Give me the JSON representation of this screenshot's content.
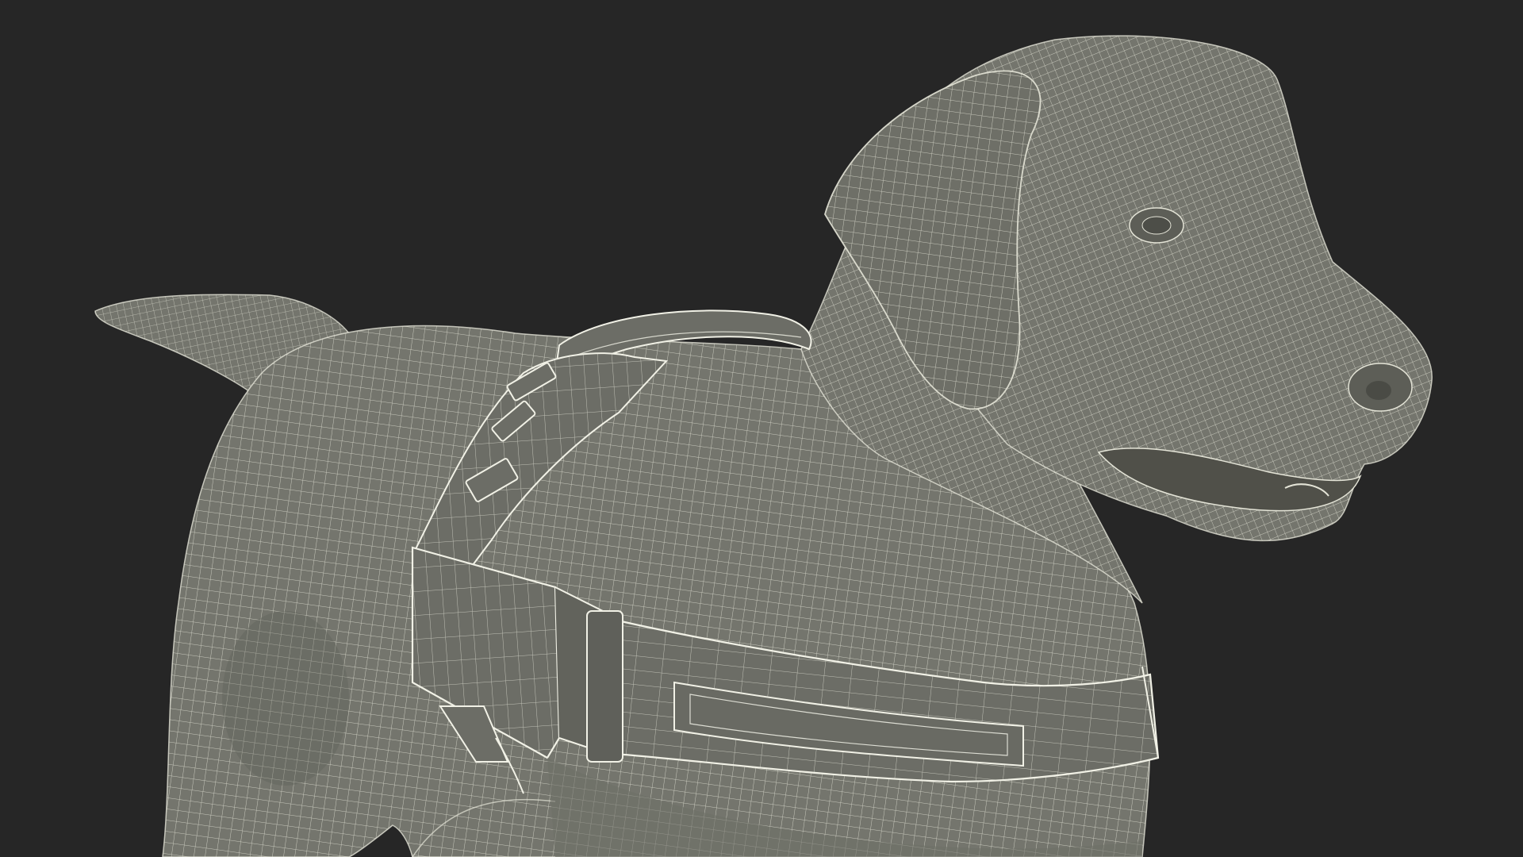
{
  "scene": {
    "background_color": "#262626",
    "subject": "dog-with-harness-wireframe",
    "mesh_fill_color": "#74756d",
    "mesh_shadow_color": "#5d5e57",
    "wire_color": "#e4e4d7",
    "harness_fill_color": "#6c6d66",
    "harness_edge_color": "#f1f1e6"
  }
}
